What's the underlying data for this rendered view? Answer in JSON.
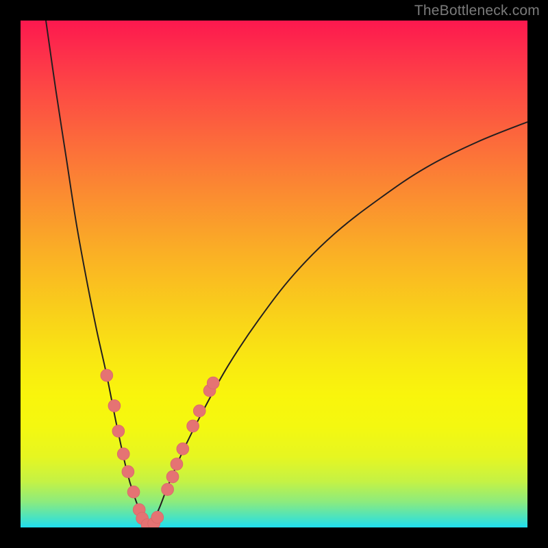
{
  "watermark": {
    "text": "TheBottleneck.com"
  },
  "colors": {
    "curve_stroke": "#231f20",
    "marker_fill": "#e57373",
    "marker_stroke": "#d96a6a"
  },
  "chart_data": {
    "type": "line",
    "title": "",
    "xlabel": "",
    "ylabel": "",
    "xlim": [
      0,
      100
    ],
    "ylim": [
      0,
      100
    ],
    "grid": false,
    "series": [
      {
        "name": "bottleneck-curve-left",
        "x": [
          5,
          7,
          9,
          11,
          13,
          15,
          17,
          19,
          21,
          22.5,
          24,
          25
        ],
        "y": [
          100,
          86,
          73,
          60,
          49,
          39,
          30,
          20,
          11,
          6,
          2,
          0
        ]
      },
      {
        "name": "bottleneck-curve-right",
        "x": [
          25,
          27,
          29,
          32,
          36,
          41,
          47,
          54,
          62,
          71,
          80,
          90,
          100
        ],
        "y": [
          0,
          3,
          8,
          15,
          23,
          32,
          41,
          50,
          58,
          65,
          71,
          76,
          80
        ]
      }
    ],
    "markers": [
      {
        "name": "left-1",
        "x": 17.0,
        "y": 30.0
      },
      {
        "name": "left-2",
        "x": 18.5,
        "y": 24.0
      },
      {
        "name": "left-3",
        "x": 19.3,
        "y": 19.0
      },
      {
        "name": "left-4",
        "x": 20.3,
        "y": 14.5
      },
      {
        "name": "left-5",
        "x": 21.2,
        "y": 11.0
      },
      {
        "name": "left-6",
        "x": 22.3,
        "y": 7.0
      },
      {
        "name": "left-7",
        "x": 23.4,
        "y": 3.5
      },
      {
        "name": "left-8",
        "x": 24.0,
        "y": 1.8
      },
      {
        "name": "bottom-1",
        "x": 25.0,
        "y": 0.5
      },
      {
        "name": "bottom-2",
        "x": 26.3,
        "y": 0.8
      },
      {
        "name": "bottom-3",
        "x": 27.0,
        "y": 2.0
      },
      {
        "name": "right-1",
        "x": 29.0,
        "y": 7.5
      },
      {
        "name": "right-2",
        "x": 30.0,
        "y": 10.0
      },
      {
        "name": "right-3",
        "x": 30.8,
        "y": 12.5
      },
      {
        "name": "right-4",
        "x": 32.0,
        "y": 15.5
      },
      {
        "name": "right-5",
        "x": 34.0,
        "y": 20.0
      },
      {
        "name": "right-6",
        "x": 35.3,
        "y": 23.0
      },
      {
        "name": "right-7",
        "x": 37.3,
        "y": 27.0
      },
      {
        "name": "right-8",
        "x": 38.0,
        "y": 28.5
      }
    ],
    "marker_radius": 1.2
  }
}
